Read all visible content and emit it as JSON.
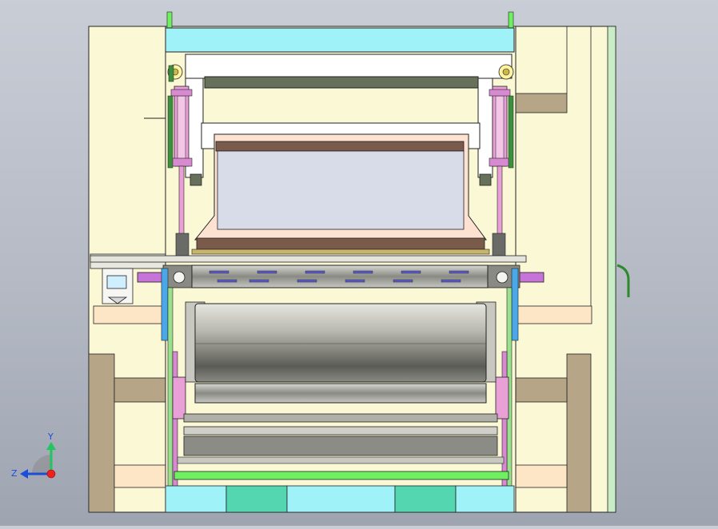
{
  "viewport": {
    "background_top": "#c9cdd6",
    "background_bottom": "#9ea4b0"
  },
  "triad": {
    "axis_y_label": "Y",
    "axis_z_label": "Z",
    "y_color": "#22c55e",
    "z_color": "#1d4ed8",
    "origin_color": "#ef2020"
  },
  "colors": {
    "frame_cream": "#fbf8d6",
    "cyan_panel": "#9ef2f8",
    "teal_panel": "#54d6b0",
    "roller_steel": "#9a9a92",
    "cylinder_pink": "#e9a0d6",
    "hopper_peach": "#fde2d2",
    "brown_plate": "#7a5a4a",
    "khaki_block": "#b6a587",
    "green_rod": "#6ef060",
    "violet_shaft": "#c674d8",
    "olive_slot": "#66705a"
  }
}
